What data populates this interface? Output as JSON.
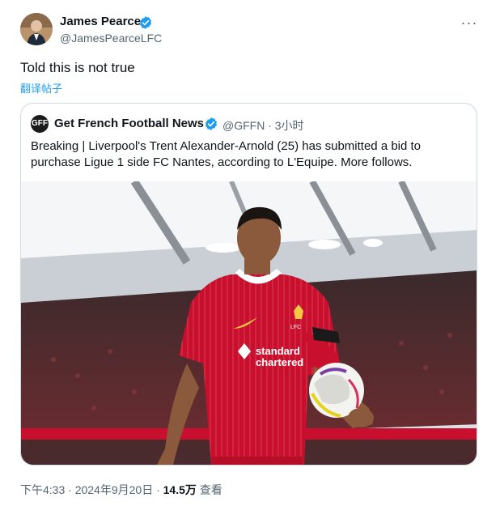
{
  "author": {
    "name": "James Pearce",
    "handle": "@JamesPearceLFC",
    "verified_color": "#1d9bf0"
  },
  "tweet": {
    "text": "Told this is not true",
    "translate_label": "翻译帖子"
  },
  "quote": {
    "logo_text": "GFF",
    "name": "Get French Football News",
    "handle_time": "@GFFN · 3小时",
    "text": "Breaking | Liverpool's Trent Alexander-Arnold (25) has submitted a bid to purchase Ligue 1 side FC Nantes, according to L'Equipe. More follows.",
    "image": {
      "shirt_sponsor_line1": "standard",
      "shirt_sponsor_line2": "chartered",
      "badge_text": "LFC",
      "shirt_color": "#c8102e"
    }
  },
  "footer": {
    "time_date": "下午4:33 · 2024年9月20日 · ",
    "views_count": "14.5万",
    "views_label": " 查看"
  },
  "more_icon_label": "···"
}
